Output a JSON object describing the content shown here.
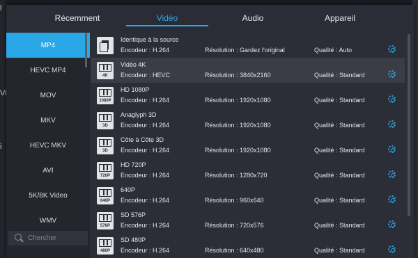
{
  "colors": {
    "accent": "#2aa7e6",
    "panel": "#2b2e36",
    "sidebar": "#23262d"
  },
  "background": {
    "edge_labels": [
      "l",
      "Vi",
      "i"
    ]
  },
  "tabs": [
    {
      "label": "Récemment"
    },
    {
      "label": "Vidéo"
    },
    {
      "label": "Audio"
    },
    {
      "label": "Appareil"
    }
  ],
  "sidebar": {
    "items": [
      {
        "label": "MP4"
      },
      {
        "label": "HEVC MP4"
      },
      {
        "label": "MOV"
      },
      {
        "label": "MKV"
      },
      {
        "label": "HEVC MKV"
      },
      {
        "label": "AVI"
      },
      {
        "label": "5K/8K Video"
      },
      {
        "label": "WMV"
      }
    ],
    "search_placeholder": "Chercher"
  },
  "formats": [
    {
      "name": "Identique à la source",
      "icon_tag": "",
      "encoder": "Encodeur : H.264",
      "resolution": "Résolution : Gardez l'original",
      "quality": "Qualité : Auto"
    },
    {
      "name": "Vidéo 4K",
      "icon_tag": "4K",
      "encoder": "Encodeur : HEVC",
      "resolution": "Résolution : 3840x2160",
      "quality": "Qualité : Standard"
    },
    {
      "name": "HD 1080P",
      "icon_tag": "1080P",
      "encoder": "Encodeur : H.264",
      "resolution": "Résolution : 1920x1080",
      "quality": "Qualité : Standard"
    },
    {
      "name": "Anaglyph 3D",
      "icon_tag": "3D",
      "encoder": "Encodeur : H.264",
      "resolution": "Résolution : 1920x1080",
      "quality": "Qualité : Standard"
    },
    {
      "name": "Côte à Côte 3D",
      "icon_tag": "3D",
      "encoder": "Encodeur : H.264",
      "resolution": "Résolution : 1920x1080",
      "quality": "Qualité : Standard"
    },
    {
      "name": "HD 720P",
      "icon_tag": "720P",
      "encoder": "Encodeur : H.264",
      "resolution": "Résolution : 1280x720",
      "quality": "Qualité : Standard"
    },
    {
      "name": "640P",
      "icon_tag": "640P",
      "encoder": "Encodeur : H.264",
      "resolution": "Résolution : 960x640",
      "quality": "Qualité : Standard"
    },
    {
      "name": "SD 576P",
      "icon_tag": "576P",
      "encoder": "Encodeur : H.264",
      "resolution": "Résolution : 720x576",
      "quality": "Qualité : Standard"
    },
    {
      "name": "SD 480P",
      "icon_tag": "480P",
      "encoder": "Encodeur : H.264",
      "resolution": "Résolution : 640x480",
      "quality": "Qualité : Standard"
    }
  ]
}
